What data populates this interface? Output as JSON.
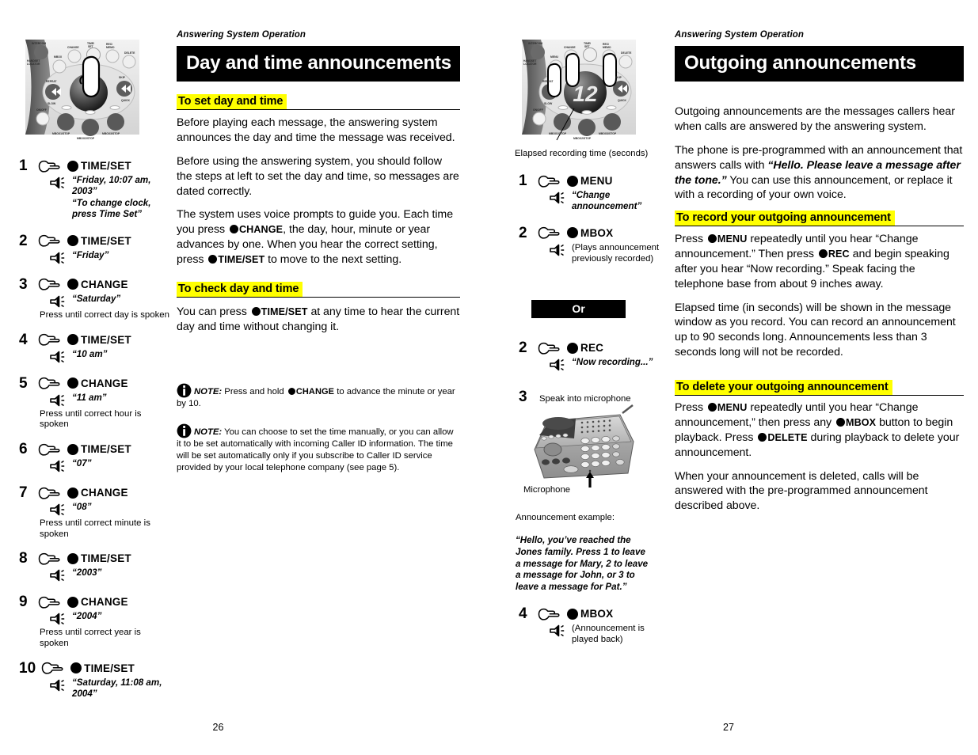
{
  "document": {
    "running_head": "Answering System Operation"
  },
  "left_page": {
    "page_number": "26",
    "chapter_title": "Day and time announcements",
    "illustration": {
      "name": "telephone-base-control-panel",
      "button_labels": [
        "INTERCOM",
        "HANDSET LOCATOR",
        "MBOX",
        "CHANGE",
        "TIME/SET",
        "REC/MEMO",
        "DELETE",
        "REPEAT",
        "SLOW",
        "SKIP",
        "QUICK",
        "ON/OFF",
        "MBOX1/STOP",
        "MBOX2/STOP",
        "MBOX3/STOP"
      ]
    },
    "sections": [
      {
        "heading": "To set day and time",
        "paragraphs": [
          "Before playing each message, the answering system announces the day and time the message was received.",
          "Before using the answering system, you should follow the steps at left to set the day and time, so messages are dated correctly."
        ]
      },
      {
        "heading": "To check day and time",
        "paragraphs": []
      }
    ],
    "voice_prompt_paragraph": {
      "part1": "The system uses voice prompts to guide you. Each time you press",
      "button1": "CHANGE",
      "part2": ", the day, hour, minute or year advances by one. When you hear the correct setting, press",
      "button2": "TIME/SET",
      "part3": "to move to the next setting."
    },
    "check_paragraph": {
      "part1": "You can press",
      "button1": "TIME/SET",
      "part2": "at any time to hear the current day and time without changing it."
    },
    "notes": [
      {
        "label": "NOTE:",
        "part1": "Press and hold",
        "button": "CHANGE",
        "part2": "to advance the minute or year by 10."
      },
      {
        "label": "NOTE:",
        "text": "You can choose to set the time manually, or you can allow it to be set automatically with incoming Caller ID information. The time will be set automatically only if you subscribe to Caller ID service provided by your local telephone company (see page 5)."
      }
    ],
    "steps": [
      {
        "num": "1",
        "button": "TIME/SET",
        "voice": [
          "“Friday, 10:07 am, 2003”",
          "“To change clock,",
          "press Time Set”"
        ]
      },
      {
        "num": "2",
        "button": "TIME/SET",
        "voice": [
          "“Friday”"
        ]
      },
      {
        "num": "3",
        "button": "CHANGE",
        "voice": [
          "“Saturday”"
        ],
        "footnote": "Press until correct day is spoken"
      },
      {
        "num": "4",
        "button": "TIME/SET",
        "voice": [
          "“10 am”"
        ]
      },
      {
        "num": "5",
        "button": "CHANGE",
        "voice": [
          "“11 am”"
        ],
        "footnote": "Press until correct hour is spoken"
      },
      {
        "num": "6",
        "button": "TIME/SET",
        "voice": [
          "“07”"
        ]
      },
      {
        "num": "7",
        "button": "CHANGE",
        "voice": [
          "“08”"
        ],
        "footnote": "Press until correct minute is spoken"
      },
      {
        "num": "8",
        "button": "TIME/SET",
        "voice": [
          "“2003”"
        ]
      },
      {
        "num": "9",
        "button": "CHANGE",
        "voice": [
          "“2004”"
        ],
        "footnote": "Press until correct year is spoken"
      },
      {
        "num": "10",
        "button": "TIME/SET",
        "voice": [
          "“Saturday, 11:08 am, 2004”"
        ]
      }
    ]
  },
  "right_page": {
    "page_number": "27",
    "chapter_title": "Outgoing announcements",
    "illustration": {
      "name": "telephone-base-control-panel-recording",
      "display_value": "12",
      "caption": "Elapsed recording time (seconds)"
    },
    "intro_paragraphs": [
      "Outgoing announcements are the messages callers hear when calls are answered by the answering system."
    ],
    "preprogrammed_paragraph": {
      "part1": "The phone is pre-programmed with an announcement that answers calls with",
      "quote": "“Hello. Please leave a message after the tone.”",
      "part2": "You can use this announcement, or replace it with a recording of your own voice."
    },
    "sections": [
      {
        "heading": "To record your outgoing announcement"
      },
      {
        "heading": "To delete your outgoing announcement"
      }
    ],
    "record_paragraph": {
      "part1": "Press",
      "button1": "MENU",
      "part2": "repeatedly until you hear “Change announcement.” Then press",
      "button2": "REC",
      "part3": "and begin speaking after you hear “Now recording.” Speak facing the telephone base from about 9 inches away."
    },
    "elapsed_paragraph": "Elapsed time (in seconds) will be shown in the message window as you record. You can record an announcement up to 90 seconds long. Announcements less than 3 seconds long will not be recorded.",
    "delete_paragraph": {
      "part1": "Press",
      "button1": "MENU",
      "part2": "repeatedly until you hear “Change announcement,” then press any",
      "button2": "MBOX",
      "part3": "button to begin playback. Press",
      "button3": "DELETE",
      "part4": "during playback to delete your announcement."
    },
    "deleted_paragraph": "When your announcement is deleted, calls will be answered with the pre-programmed announcement described above.",
    "or_label": "Or",
    "steps_a": [
      {
        "num": "1",
        "button": "MENU",
        "voice": [
          "“Change",
          "announcement”"
        ],
        "voice_style": "italic"
      },
      {
        "num": "2",
        "button": "MBOX",
        "voice": [
          "(Plays announcement",
          "previously recorded)"
        ],
        "voice_style": "plain"
      }
    ],
    "steps_b": [
      {
        "num": "2",
        "button": "REC",
        "voice": [
          "“Now recording...”"
        ],
        "voice_style": "italic"
      }
    ],
    "step3": {
      "num": "3",
      "label": "Speak into microphone",
      "mic_label": "Microphone",
      "example_label": "Announcement example:",
      "example_lines": [
        "“Hello, you’ve reached the",
        "Jones family. Press 1 to leave",
        "a message for Mary, 2 to leave",
        "a message for John, or 3 to",
        "leave a message for Pat.”"
      ]
    },
    "step4": {
      "num": "4",
      "button": "MBOX",
      "voice": [
        "(Announcement is",
        "played back)"
      ],
      "voice_style": "plain"
    }
  },
  "colors": {
    "highlight": "#ffff00",
    "bar": "#000000",
    "text": "#000000",
    "paper": "#ffffff"
  }
}
